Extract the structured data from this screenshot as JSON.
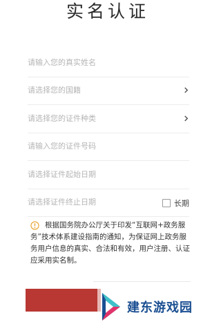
{
  "page": {
    "title": "实名认证"
  },
  "form": {
    "name_placeholder": "请输入您的真实姓名",
    "nationality_placeholder": "请选择您的国籍",
    "id_type_placeholder": "请选择您的证件种类",
    "id_number_placeholder": "请输入您的证件号码",
    "start_date_placeholder": "请选择证件起始日期",
    "end_date_placeholder": "请选择证件终止日期",
    "long_term_label": "长期",
    "long_term_checked": false
  },
  "notice": {
    "icon": "warning-icon",
    "text": "根据国务院办公厅关于印发“互联网+政务服务”技术体系建设指南的通知，为保证网上政务服务用户信息的真实、合法和有效，用户注册、认证应采用实名制。"
  },
  "watermark": {
    "text": "建东游戏园",
    "logo_icon": "play-logo-icon"
  },
  "colors": {
    "primary": "#b93833",
    "watermark_text": "#1b4f92",
    "warning": "#e8a22a",
    "placeholder": "#b5b5b5"
  }
}
